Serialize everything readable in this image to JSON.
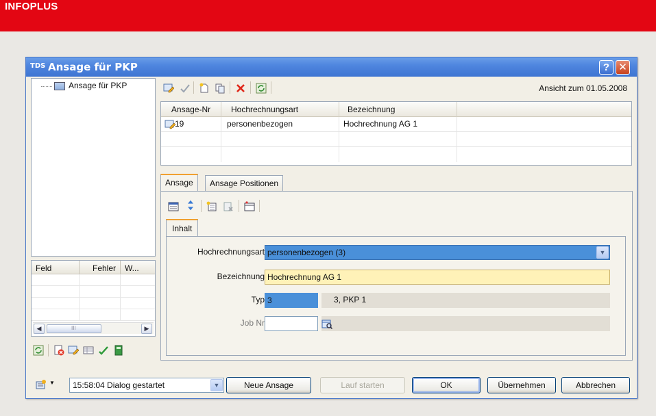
{
  "banner": {
    "title": "INFOPLUS"
  },
  "window": {
    "logo": "TDS",
    "title": "Ansage für PKP",
    "help_label": "?",
    "close_label": "✕"
  },
  "tree": {
    "items": [
      {
        "label": "Ansage für PKP"
      }
    ]
  },
  "error_list": {
    "columns": [
      "Feld",
      "Fehler",
      "W..."
    ],
    "scroll_left": "◀",
    "scroll_right": "▶",
    "thumb_label": "III"
  },
  "toolbar": {
    "view_date": "Ansicht zum 01.05.2008"
  },
  "grid": {
    "columns": [
      "Ansage-Nr",
      "Hochrechnungsart",
      "Bezeichnung"
    ],
    "rows": [
      {
        "nr": "19",
        "art": "personenbezogen",
        "bez": "Hochrechnung AG 1"
      }
    ]
  },
  "tabs": [
    {
      "label": "Ansage"
    },
    {
      "label": "Ansage Positionen"
    }
  ],
  "inner_tab": {
    "label": "Inhalt"
  },
  "form": {
    "hochrechnungsart_label": "Hochrechnungsart",
    "hochrechnungsart_value": "personenbezogen (3)",
    "bezeichnung_label": "Bezeichnung",
    "bezeichnung_value": "Hochrechnung AG 1",
    "typ_label": "Typ",
    "typ_value": "3",
    "typ_lookup": "3, PKP 1",
    "jobnr_label": "Job Nr",
    "jobnr_value": ""
  },
  "bottom": {
    "status": "15:58:04 Dialog gestartet",
    "new_label": "Neue Ansage",
    "run_label": "Lauf starten",
    "ok_label": "OK",
    "apply_label": "Übernehmen",
    "cancel_label": "Abbrechen"
  },
  "colors": {
    "banner": "#e30613",
    "titlebar": "#3e74d2",
    "selected_field": "#4a90d9",
    "highlight_field": "#fff2b8"
  }
}
